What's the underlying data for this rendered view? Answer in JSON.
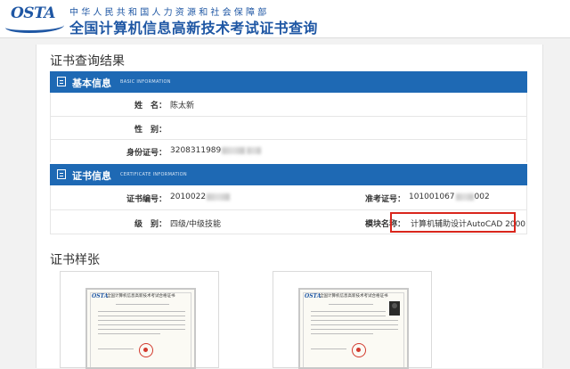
{
  "header": {
    "logo_text": "OSTA",
    "subtitle": "中华人民共和国人力资源和社会保障部",
    "title": "全国计算机信息高新技术考试证书查询"
  },
  "result_heading": "证书查询结果",
  "basic_panel": {
    "title": "基本信息",
    "title_en": "BASIC INFORMATION",
    "rows": [
      {
        "label": "姓　名：",
        "value": "陈太新"
      },
      {
        "label": "性　别：",
        "value": ""
      },
      {
        "label": "身份证号：",
        "value": "3208311989"
      }
    ]
  },
  "cert_panel": {
    "title": "证书信息",
    "title_en": "CERTIFICATE INFORMATION",
    "rows": [
      {
        "label": "证书编号：",
        "value": "2010022",
        "label2": "准考证号：",
        "value2_prefix": "101001067",
        "value2_suffix": "002"
      },
      {
        "label": "级　别：",
        "value": "四级/中级技能",
        "label2": "模块名称：",
        "value2": "计算机辅助设计AutoCAD 2000"
      }
    ]
  },
  "sample_heading": "证书样张",
  "samples": [
    {
      "logo": "OSTA",
      "title": "全国计算机信息高新技术考试合格证书"
    },
    {
      "logo": "OSTA",
      "title": "全国计算机信息高新技术考试合格证书"
    }
  ],
  "colors": {
    "brand_blue": "#1f57a4",
    "panel_blue": "#1e69b4",
    "highlight_red": "#d9261c"
  }
}
